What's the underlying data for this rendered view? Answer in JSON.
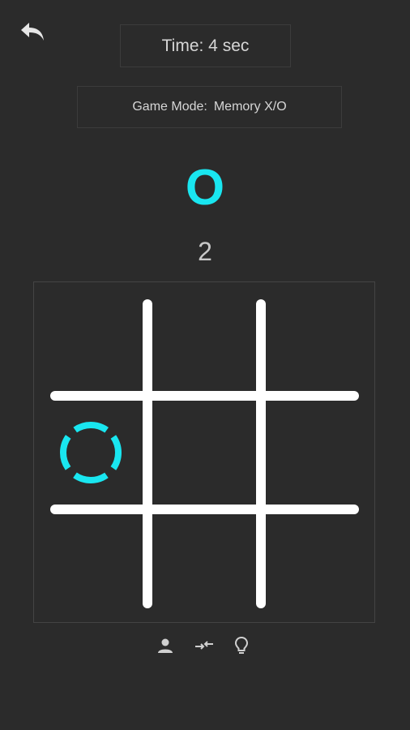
{
  "header": {
    "timer_text": "Time: 4 sec",
    "mode_label": "Game Mode:",
    "mode_value": "Memory X/O"
  },
  "status": {
    "current_symbol": "O",
    "move_count": "2"
  },
  "board": {
    "cells": [
      "",
      "",
      "",
      "O",
      "",
      "",
      "",
      "",
      ""
    ],
    "o_style": "dashed-ring"
  },
  "toolbar": {
    "items": [
      "person-icon",
      "swap-icon",
      "lightbulb-icon"
    ]
  },
  "colors": {
    "background": "#2b2b2b",
    "accent": "#19e6f0",
    "grid": "#ffffff",
    "text": "#d6d6d6"
  }
}
